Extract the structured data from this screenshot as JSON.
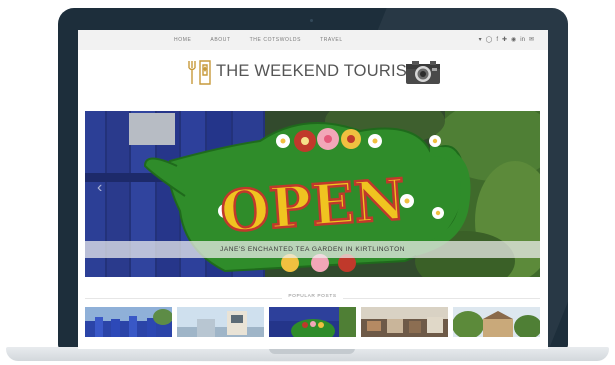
{
  "nav": {
    "links": [
      "HOME",
      "ABOUT",
      "THE COTSWOLDS",
      "TRAVEL"
    ],
    "social_icons": [
      "twitter-icon",
      "instagram-icon",
      "facebook-icon",
      "bloglovin-icon",
      "pinterest-icon",
      "linkedin-icon",
      "email-icon"
    ]
  },
  "logo": {
    "text": "THE WEEKEND TOURIST"
  },
  "hero": {
    "sign_text": "OPEN",
    "caption": "JANE'S ENCHANTED TEA GARDEN IN KIRTLINGTON"
  },
  "popular": {
    "label": "POPULAR POSTS"
  },
  "colors": {
    "laptop_frame": "#1d2e3b",
    "nav_bar": "#f2f2f2",
    "logo_gold": "#c79a3b",
    "teapot_green": "#2f8c2a",
    "fence_blue": "#2b3d8f"
  }
}
